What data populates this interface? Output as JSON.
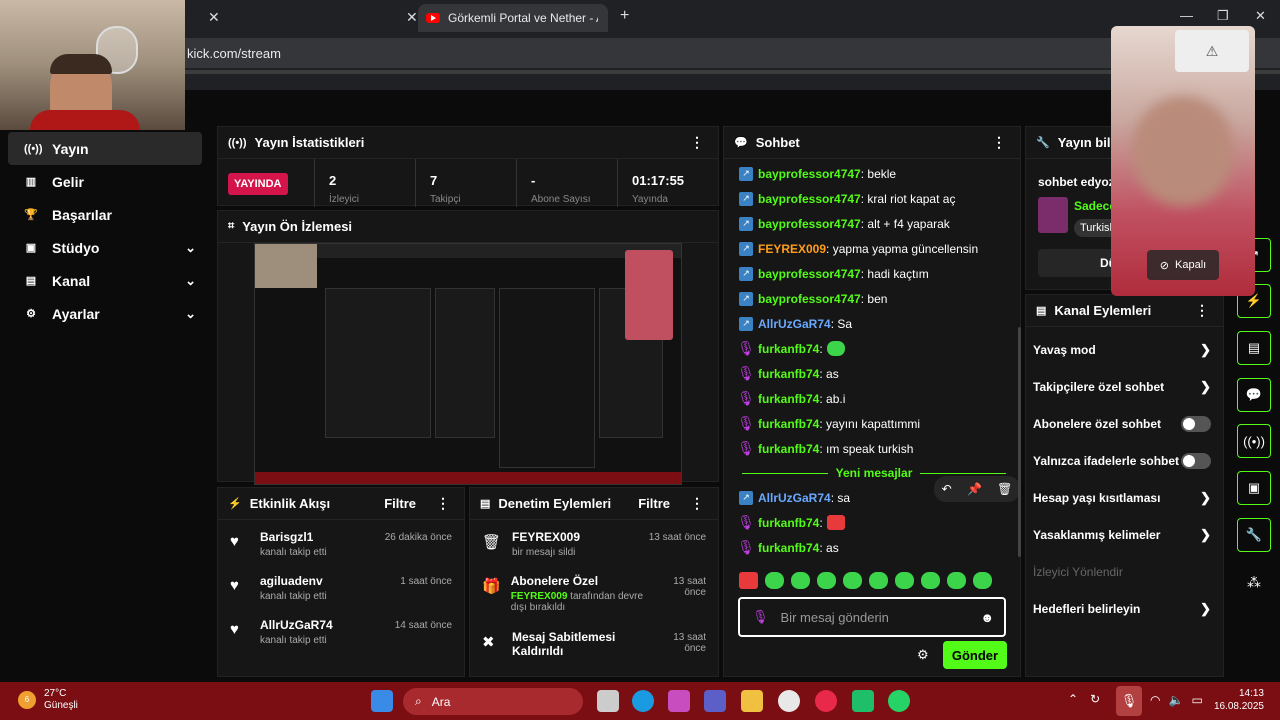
{
  "browser": {
    "tab_title": "Görkemli Portal ve Nether - Abo",
    "url": "kick.com/stream"
  },
  "sidebar": {
    "items": [
      {
        "label": "Yayın",
        "icon": "broadcast-icon",
        "expandable": false,
        "active": true
      },
      {
        "label": "Gelir",
        "icon": "chart-icon",
        "expandable": false
      },
      {
        "label": "Başarılar",
        "icon": "trophy-icon",
        "expandable": false
      },
      {
        "label": "Stüdyo",
        "icon": "studio-icon",
        "expandable": true
      },
      {
        "label": "Kanal",
        "icon": "channel-icon",
        "expandable": true
      },
      {
        "label": "Ayarlar",
        "icon": "gear-icon",
        "expandable": true
      }
    ]
  },
  "stats": {
    "title": "Yayın İstatistikleri",
    "live_badge": "YAYINDA",
    "viewers": "2",
    "viewers_label": "İzleyici",
    "followers": "7",
    "followers_label": "Takipçi",
    "subs": "-",
    "subs_label": "Abone Sayısı",
    "duration": "01:17:55",
    "duration_label": "Yayında"
  },
  "preview": {
    "title": "Yayın Ön İzlemesi"
  },
  "activity": {
    "title": "Etkinlik Akışı",
    "filter_label": "Filtre",
    "events": [
      {
        "name": "Barisgzl1",
        "desc": "kanalı takip etti",
        "time": "26 dakika önce"
      },
      {
        "name": "agiluadenv",
        "desc": "kanalı takip etti",
        "time": "1 saat önce"
      },
      {
        "name": "AllrUzGaR74",
        "desc": "kanalı takip etti",
        "time": "14 saat önce"
      }
    ]
  },
  "moderation": {
    "title": "Denetim Eylemleri",
    "filter_label": "Filtre",
    "events": [
      {
        "name": "FEYREX009",
        "desc": "bir mesajı sildi",
        "time": "13 saat önce"
      },
      {
        "name": "Abonelere Özel",
        "desc_user": "FEYREX009",
        "desc": "tarafından devre dışı bırakıldı",
        "time": "13 saat önce"
      },
      {
        "name": "Mesaj Sabitlemesi Kaldırıldı",
        "time": "13 saat önce"
      }
    ]
  },
  "chat": {
    "title": "Sohbet",
    "messages": [
      {
        "user": "bayprofessor4747",
        "text": ": bekle",
        "color": "#53fc18"
      },
      {
        "user": "bayprofessor4747",
        "text": ": kral riot kapat aç",
        "color": "#53fc18"
      },
      {
        "user": "bayprofessor4747",
        "text": ": alt + f4 yaparak",
        "color": "#53fc18"
      },
      {
        "user": "FEYREX009",
        "text": ": yapma yapma güncellensin",
        "color": "#ff9d1c"
      },
      {
        "user": "bayprofessor4747",
        "text": ": hadi kaçtım",
        "color": "#53fc18"
      },
      {
        "user": "bayprofessor4747",
        "text": ": ben",
        "color": "#53fc18"
      },
      {
        "user": "AllrUzGaR74",
        "text": ": Sa",
        "color": "#6aa9ff"
      },
      {
        "user": "furkanfb74",
        "text": ":",
        "color": "#53fc18"
      },
      {
        "user": "furkanfb74",
        "text": ": as",
        "color": "#53fc18"
      },
      {
        "user": "furkanfb74",
        "text": ": ab.i",
        "color": "#53fc18"
      },
      {
        "user": "furkanfb74",
        "text": ": yayını kapattımmi",
        "color": "#53fc18"
      },
      {
        "user": "furkanfb74",
        "text": ": ım speak turkish",
        "color": "#53fc18"
      }
    ],
    "new_messages_label": "Yeni mesajlar",
    "new_messages": [
      {
        "user": "AllrUzGaR74",
        "text": ": sa",
        "color": "#6aa9ff"
      },
      {
        "user": "furkanfb74",
        "text": ":",
        "color": "#53fc18"
      },
      {
        "user": "furkanfb74",
        "text": ": as",
        "color": "#53fc18"
      }
    ],
    "input_placeholder": "Bir mesaj gönderin",
    "send_label": "Gönder"
  },
  "info": {
    "title": "Yayın bilgisi",
    "stream_title": "sohbet edyoz",
    "category": "Sadece",
    "tag": "Turkish",
    "button": "Düzenle"
  },
  "channel_actions": {
    "title": "Kanal Eylemleri",
    "items": [
      {
        "label": "Yavaş mod",
        "type": "arrow"
      },
      {
        "label": "Takipçilere özel sohbet",
        "type": "arrow"
      },
      {
        "label": "Abonelere özel sohbet",
        "type": "toggle"
      },
      {
        "label": "Yalnızca ifadelerle sohbet",
        "type": "toggle"
      },
      {
        "label": "Hesap yaşı kısıtlaması",
        "type": "arrow"
      },
      {
        "label": "Yasaklanmış kelimeler",
        "type": "arrow"
      },
      {
        "label": "İzleyici Yönlendir",
        "type": "disabled"
      },
      {
        "label": "Hedefleri belirleyin",
        "type": "arrow"
      }
    ]
  },
  "overlay": {
    "camera_status": "Kapalı"
  },
  "taskbar": {
    "weather_temp": "27°C",
    "weather_desc": "Güneşli",
    "weather_badge": "6",
    "search_label": "Ara",
    "time": "14:13",
    "date": "16.08.2025"
  }
}
